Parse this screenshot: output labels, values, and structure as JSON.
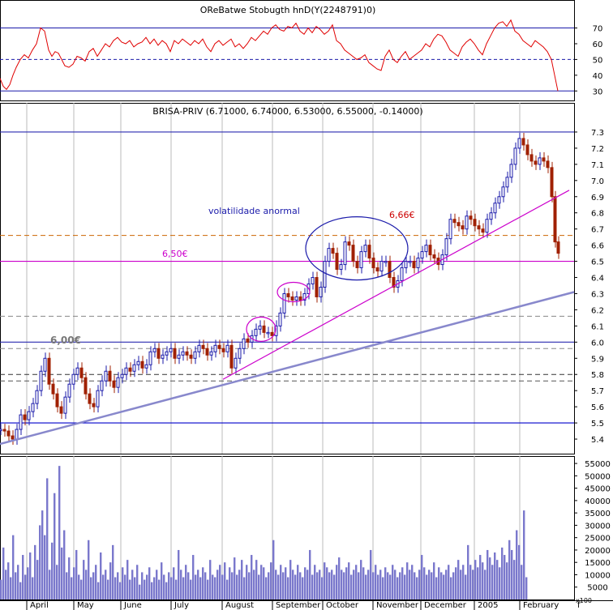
{
  "chart_data": [
    {
      "type": "line",
      "panel": "indicator",
      "title": "OReBatwe Stobugth hnD(Y(2248791)0)",
      "ylim": [
        25,
        78
      ],
      "ticks": [
        "70",
        "60",
        "50",
        "40",
        "30"
      ],
      "tick_values": [
        70,
        60,
        50,
        40,
        30
      ],
      "reference_lines": [
        70,
        50,
        30
      ],
      "series": [
        {
          "color": "#e00000",
          "x": [
            0,
            4,
            8,
            12,
            16,
            20,
            25,
            30,
            35,
            40,
            45,
            50,
            55,
            60,
            64,
            68,
            72,
            76,
            80,
            85,
            90,
            95,
            100,
            105,
            110,
            115,
            120,
            125,
            130,
            135,
            140,
            145,
            150,
            155,
            160,
            165,
            170,
            175,
            180,
            185,
            190,
            195,
            200,
            205,
            210,
            215,
            220,
            225,
            230,
            235,
            240,
            245,
            250,
            255,
            260,
            265,
            270,
            275,
            280,
            285,
            290,
            295,
            300,
            305,
            310,
            315,
            320,
            325,
            330,
            335,
            340,
            345,
            350,
            355,
            360,
            365,
            370,
            375,
            380,
            385,
            390,
            395,
            400,
            405,
            410,
            415,
            420,
            425,
            430,
            435,
            440,
            445,
            450,
            455,
            460,
            465,
            470,
            475,
            480,
            485,
            490,
            495,
            500,
            505,
            510,
            515,
            520,
            525,
            530,
            535,
            540,
            545,
            550,
            555,
            560,
            565,
            570,
            575,
            580,
            585,
            590,
            595,
            600,
            605,
            610,
            615,
            620,
            625,
            630,
            635,
            640,
            645,
            650,
            655,
            660,
            665,
            670,
            675,
            680,
            684,
            688
          ],
          "values": [
            38,
            33,
            31,
            34,
            40,
            45,
            50,
            53,
            51,
            56,
            60,
            70,
            68,
            56,
            52,
            55,
            54,
            50,
            46,
            45,
            47,
            52,
            51,
            49,
            55,
            57,
            52,
            56,
            60,
            58,
            62,
            64,
            61,
            60,
            62,
            58,
            60,
            61,
            64,
            60,
            63,
            59,
            62,
            60,
            55,
            62,
            60,
            63,
            61,
            59,
            62,
            60,
            63,
            58,
            55,
            60,
            62,
            59,
            61,
            63,
            58,
            60,
            57,
            60,
            64,
            62,
            65,
            68,
            66,
            70,
            72,
            69,
            68,
            71,
            70,
            73,
            68,
            66,
            70,
            67,
            71,
            69,
            66,
            68,
            72,
            62,
            60,
            56,
            54,
            52,
            50,
            51,
            53,
            48,
            46,
            44,
            43,
            52,
            56,
            50,
            48,
            52,
            55,
            50,
            52,
            54,
            56,
            60,
            58,
            63,
            66,
            65,
            61,
            56,
            54,
            52,
            58,
            61,
            63,
            60,
            56,
            53,
            60,
            65,
            70,
            73,
            74,
            71,
            75,
            68,
            66,
            62,
            60,
            58,
            62,
            60,
            58,
            55,
            50,
            40,
            30
          ]
        }
      ]
    },
    {
      "type": "candlestick",
      "panel": "price",
      "title": "BRISA-PRIV (6.71000, 6.74000, 6.53000, 6.55000, -0.14000)",
      "ylim": [
        5.32,
        7.38
      ],
      "ticks": [
        "7.3",
        "7.2",
        "7.1",
        "7.0",
        "6.9",
        "6.8",
        "6.7",
        "6.6",
        "6.5",
        "6.4",
        "6.3",
        "6.2",
        "6.1",
        "6.0",
        "5.9",
        "5.8",
        "5.7",
        "5.6",
        "5.5",
        "5.4"
      ],
      "tick_values": [
        7.3,
        7.2,
        7.1,
        7.0,
        6.9,
        6.8,
        6.7,
        6.6,
        6.5,
        6.4,
        6.3,
        6.2,
        6.1,
        6.0,
        5.9,
        5.8,
        5.7,
        5.6,
        5.5,
        5.4
      ],
      "close_series": {
        "x": [
          0,
          5,
          10,
          15,
          20,
          25,
          30,
          35,
          40,
          45,
          50,
          55,
          60,
          65,
          70,
          75,
          80,
          85,
          90,
          95,
          100,
          105,
          110,
          115,
          120,
          125,
          130,
          135,
          140,
          145,
          150,
          155,
          160,
          165,
          170,
          175,
          180,
          185,
          190,
          195,
          200,
          205,
          210,
          215,
          220,
          225,
          230,
          235,
          240,
          245,
          250,
          255,
          260,
          265,
          270,
          275,
          280,
          285,
          290,
          295,
          300,
          305,
          310,
          315,
          320,
          325,
          330,
          335,
          340,
          345,
          350,
          355,
          360,
          365,
          370,
          375,
          380,
          385,
          390,
          395,
          400,
          405,
          410,
          415,
          420,
          425,
          430,
          435,
          440,
          445,
          450,
          455,
          460,
          465,
          470,
          475,
          480,
          485,
          490,
          495,
          500,
          505,
          510,
          515,
          520,
          525,
          530,
          535,
          540,
          545,
          550,
          555,
          560,
          565,
          570,
          575,
          580,
          585,
          590,
          595,
          600,
          605,
          610,
          615,
          620,
          625,
          630,
          635,
          640,
          645,
          650,
          655,
          660,
          665,
          670,
          675,
          680,
          684,
          688
        ],
        "values": [
          5.46,
          5.45,
          5.42,
          5.4,
          5.46,
          5.55,
          5.52,
          5.57,
          5.62,
          5.7,
          5.82,
          5.9,
          5.74,
          5.68,
          5.6,
          5.56,
          5.66,
          5.74,
          5.8,
          5.84,
          5.78,
          5.68,
          5.62,
          5.6,
          5.7,
          5.76,
          5.82,
          5.76,
          5.72,
          5.78,
          5.8,
          5.84,
          5.82,
          5.86,
          5.88,
          5.84,
          5.86,
          5.94,
          5.96,
          5.9,
          5.92,
          5.94,
          5.96,
          5.9,
          5.92,
          5.94,
          5.92,
          5.9,
          5.94,
          5.98,
          5.96,
          5.92,
          5.94,
          5.98,
          5.96,
          5.94,
          5.98,
          5.84,
          5.9,
          5.96,
          6.02,
          6.0,
          6.04,
          6.08,
          6.1,
          6.06,
          6.06,
          6.04,
          6.1,
          6.18,
          6.3,
          6.28,
          6.26,
          6.28,
          6.26,
          6.3,
          6.36,
          6.4,
          6.28,
          6.34,
          6.5,
          6.58,
          6.55,
          6.45,
          6.48,
          6.62,
          6.6,
          6.5,
          6.46,
          6.56,
          6.6,
          6.52,
          6.46,
          6.44,
          6.5,
          6.5,
          6.4,
          6.34,
          6.38,
          6.46,
          6.5,
          6.5,
          6.46,
          6.52,
          6.56,
          6.6,
          6.54,
          6.52,
          6.48,
          6.54,
          6.64,
          6.76,
          6.74,
          6.72,
          6.7,
          6.78,
          6.76,
          6.72,
          6.7,
          6.68,
          6.76,
          6.8,
          6.86,
          6.9,
          6.96,
          7.02,
          7.1,
          7.2,
          7.26,
          7.22,
          7.16,
          7.12,
          7.1,
          7.14,
          7.12,
          7.08,
          6.9,
          6.62,
          6.55
        ]
      },
      "horizontal_lines": [
        {
          "value": 7.3,
          "color": "#2a2ab0",
          "style": "solid"
        },
        {
          "value": 6.66,
          "color": "#cc6600",
          "style": "dashed"
        },
        {
          "value": 6.5,
          "color": "#cc00cc",
          "style": "solid"
        },
        {
          "value": 6.16,
          "color": "#888888",
          "style": "dashed"
        },
        {
          "value": 6.0,
          "color": "#2a2ab0",
          "style": "solid"
        },
        {
          "value": 5.96,
          "color": "#888888",
          "style": "dashed"
        },
        {
          "value": 5.8,
          "color": "#333333",
          "style": "dashed"
        },
        {
          "value": 5.76,
          "color": "#555555",
          "style": "dashed"
        },
        {
          "value": 5.5,
          "color": "#0000cc",
          "style": "solid"
        }
      ],
      "trendlines": [
        {
          "x": [
            0,
            708
          ],
          "values": [
            5.37,
            6.31
          ],
          "color": "#8888cc"
        },
        {
          "x": [
            275,
            702
          ],
          "values": [
            5.77,
            6.94
          ],
          "color": "#cc00cc"
        }
      ],
      "ellipses": [
        {
          "cx": 322,
          "cy_value": 6.08,
          "color": "#cc00cc"
        },
        {
          "cx": 362,
          "cy_value": 6.31,
          "color": "#cc00cc"
        },
        {
          "cx": 440,
          "cy_value": 6.58,
          "color": "#1a1aaa"
        }
      ],
      "annotations": [
        {
          "text": "volatilidade anormal",
          "color": "#1a1aaa"
        },
        {
          "text": "6,66€",
          "color": "#cc0000"
        },
        {
          "text": "6,50€",
          "color": "#cc00cc"
        },
        {
          "text": "6,00€",
          "color": "#777777"
        }
      ]
    },
    {
      "type": "bar",
      "panel": "volume",
      "ylim": [
        0,
        57000
      ],
      "ticks": [
        "55000",
        "50000",
        "45000",
        "40000",
        "35000",
        "30000",
        "25000",
        "20000",
        "15000",
        "10000",
        "5000"
      ],
      "tick_values": [
        55000,
        50000,
        45000,
        40000,
        35000,
        30000,
        25000,
        20000,
        15000,
        10000,
        5000
      ],
      "unit_label": "x100",
      "x": [
        0,
        3,
        6,
        9,
        12,
        15,
        18,
        21,
        24,
        27,
        30,
        33,
        36,
        39,
        42,
        45,
        48,
        51,
        54,
        57,
        60,
        63,
        66,
        69,
        72,
        75,
        78,
        81,
        84,
        87,
        90,
        93,
        96,
        99,
        102,
        105,
        108,
        111,
        114,
        117,
        120,
        123,
        126,
        129,
        132,
        135,
        138,
        141,
        144,
        147,
        150,
        153,
        156,
        159,
        162,
        165,
        168,
        171,
        174,
        177,
        180,
        183,
        186,
        189,
        192,
        195,
        198,
        201,
        204,
        207,
        210,
        213,
        216,
        219,
        222,
        225,
        228,
        231,
        234,
        237,
        240,
        243,
        246,
        249,
        252,
        255,
        258,
        261,
        264,
        267,
        270,
        273,
        276,
        279,
        282,
        285,
        288,
        291,
        294,
        297,
        300,
        303,
        306,
        309,
        312,
        315,
        318,
        321,
        324,
        327,
        330,
        333,
        336,
        339,
        342,
        345,
        348,
        351,
        354,
        357,
        360,
        363,
        366,
        369,
        372,
        375,
        378,
        381,
        384,
        387,
        390,
        393,
        396,
        399,
        402,
        405,
        408,
        411,
        414,
        417,
        420,
        423,
        426,
        429,
        432,
        435,
        438,
        441,
        444,
        447,
        450,
        453,
        456,
        459,
        462,
        465,
        468,
        471,
        474,
        477,
        480,
        483,
        486,
        489,
        492,
        495,
        498,
        501,
        504,
        507,
        510,
        513,
        516,
        519,
        522,
        525,
        528,
        531,
        534,
        537,
        540,
        543,
        546,
        549,
        552,
        555,
        558,
        561,
        564,
        567,
        570,
        573,
        576,
        579,
        582,
        585,
        588,
        591,
        594,
        597,
        600,
        603,
        606,
        609,
        612,
        615,
        618,
        621,
        624,
        627,
        630,
        633,
        636,
        639,
        642,
        645,
        648,
        651,
        654,
        657,
        660,
        663,
        666,
        669,
        672,
        675,
        678,
        681,
        684,
        687
      ],
      "values": [
        8000,
        21000,
        12000,
        15000,
        9000,
        26000,
        11000,
        14000,
        7000,
        18000,
        10000,
        13000,
        19000,
        9000,
        22000,
        16000,
        30000,
        36000,
        26000,
        49000,
        12000,
        23000,
        43000,
        14000,
        54000,
        21000,
        28000,
        11000,
        17000,
        9000,
        13000,
        20000,
        10000,
        8000,
        16000,
        12000,
        24000,
        9000,
        11000,
        14000,
        7000,
        19000,
        10000,
        12000,
        8000,
        15000,
        22000,
        9000,
        11000,
        7000,
        13000,
        10000,
        16000,
        8000,
        12000,
        9000,
        14000,
        6000,
        11000,
        8000,
        10000,
        13000,
        7000,
        9000,
        12000,
        8000,
        15000,
        10000,
        7000,
        11000,
        9000,
        13000,
        8000,
        20000,
        12000,
        9000,
        14000,
        11000,
        8000,
        18000,
        10000,
        12000,
        9000,
        13000,
        11000,
        8000,
        16000,
        10000,
        9000,
        12000,
        14000,
        10000,
        15000,
        8000,
        13000,
        11000,
        17000,
        10000,
        12000,
        16000,
        9000,
        14000,
        11000,
        18000,
        12000,
        16000,
        10000,
        14000,
        13000,
        9000,
        11000,
        15000,
        24000,
        12000,
        10000,
        14000,
        11000,
        13000,
        9000,
        16000,
        12000,
        10000,
        14000,
        11000,
        9000,
        13000,
        12000,
        20000,
        10000,
        14000,
        11000,
        12000,
        9000,
        15000,
        13000,
        11000,
        12000,
        10000,
        14000,
        17000,
        12000,
        11000,
        13000,
        15000,
        10000,
        12000,
        14000,
        11000,
        16000,
        13000,
        10000,
        12000,
        20000,
        11000,
        14000,
        10000,
        12000,
        9000,
        13000,
        11000,
        10000,
        14000,
        12000,
        9000,
        11000,
        13000,
        10000,
        15000,
        12000,
        14000,
        11000,
        9000,
        12000,
        18000,
        13000,
        10000,
        12000,
        11000,
        15000,
        9000,
        13000,
        11000,
        10000,
        12000,
        14000,
        9000,
        11000,
        13000,
        16000,
        12000,
        14000,
        10000,
        22000,
        14000,
        12000,
        16000,
        13000,
        18000,
        15000,
        12000,
        20000,
        17000,
        14000,
        19000,
        16000,
        13000,
        21000,
        18000,
        15000,
        24000,
        20000,
        16000,
        28000,
        22000,
        14000,
        36000,
        9000
      ]
    }
  ],
  "x_axis": {
    "months": [
      "April",
      "May",
      "June",
      "July",
      "August",
      "September",
      "October",
      "November",
      "December",
      "2005",
      "February"
    ],
    "month_x": [
      37,
      95,
      153,
      215,
      278,
      340,
      402,
      464,
      523,
      589,
      645
    ],
    "last_label": "f"
  }
}
